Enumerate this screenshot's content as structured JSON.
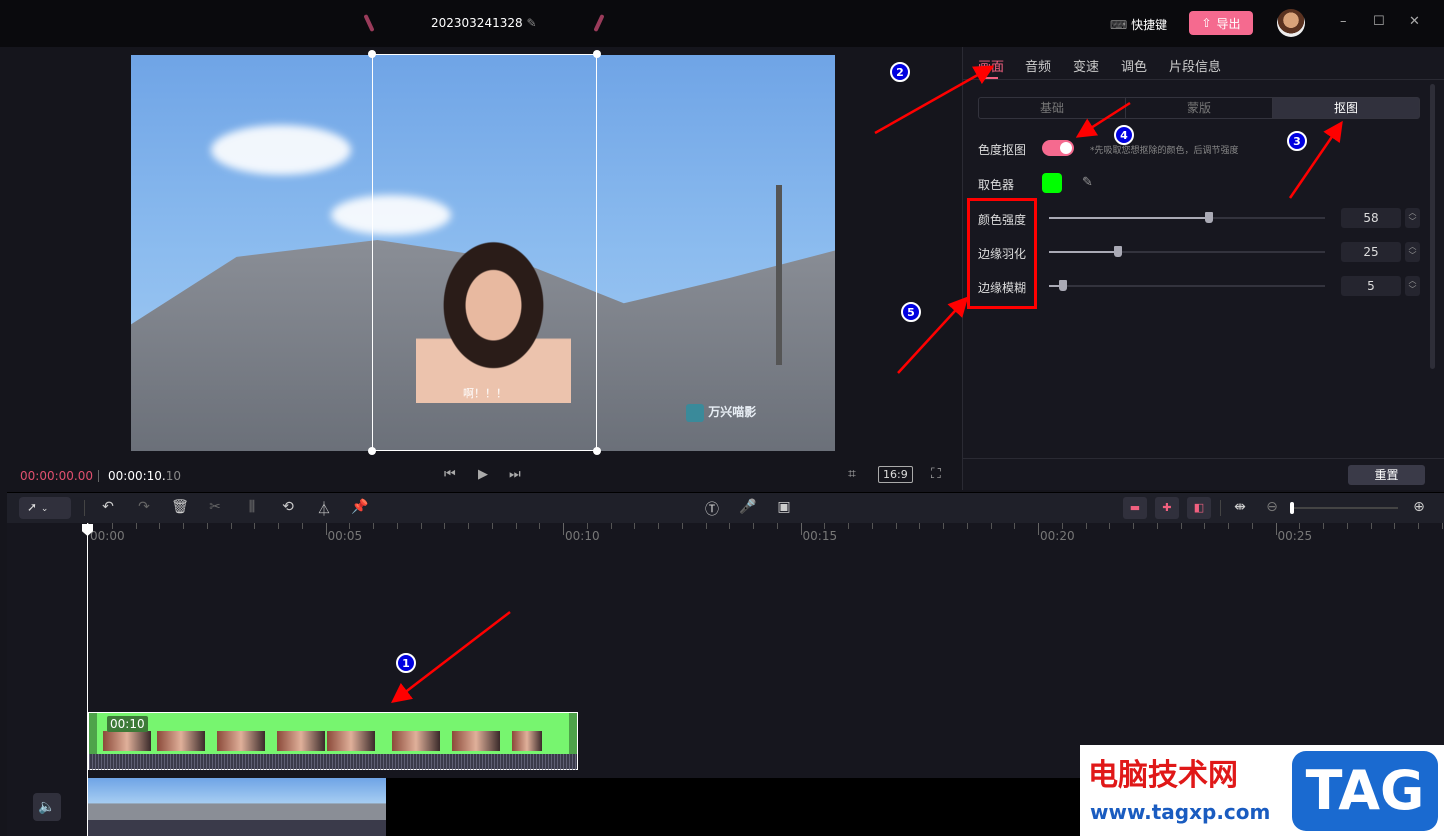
{
  "titlebar": {
    "project_name": "202303241328",
    "shortcut_label": "快捷键",
    "export_label": "导出",
    "minimize": "–",
    "maximize": "☐",
    "close": "✕"
  },
  "preview": {
    "subtitle": "啊！！！",
    "watermark": "万兴喵影",
    "current_time": "00:00:00.00",
    "total_time_main": "00:00:10.",
    "total_time_frac": "10",
    "aspect_ratio": "16:9"
  },
  "panel": {
    "tabs": [
      "画面",
      "音频",
      "变速",
      "调色",
      "片段信息"
    ],
    "subtabs": [
      "基础",
      "蒙版",
      "抠图"
    ],
    "chroma_label": "色度抠图",
    "chroma_enabled": true,
    "hint": "*先吸取您想抠除的颜色，后调节强度",
    "picker_label": "取色器",
    "picker_color": "#00ff00",
    "sliders": [
      {
        "label": "颜色强度",
        "value": "58",
        "fraction": 0.58
      },
      {
        "label": "边缘羽化",
        "value": "25",
        "fraction": 0.25
      },
      {
        "label": "边缘模糊",
        "value": "5",
        "fraction": 0.05
      }
    ],
    "reset_label": "重置"
  },
  "timeline": {
    "ruler": [
      "00:00",
      "00:05",
      "00:10",
      "00:15",
      "00:20",
      "00:25"
    ],
    "clip_duration": "00:10"
  },
  "annotations": [
    "1",
    "2",
    "3",
    "4",
    "5"
  ],
  "site_watermark": {
    "name": "电脑技术网",
    "url": "www.tagxp.com",
    "logo": "TAG"
  }
}
